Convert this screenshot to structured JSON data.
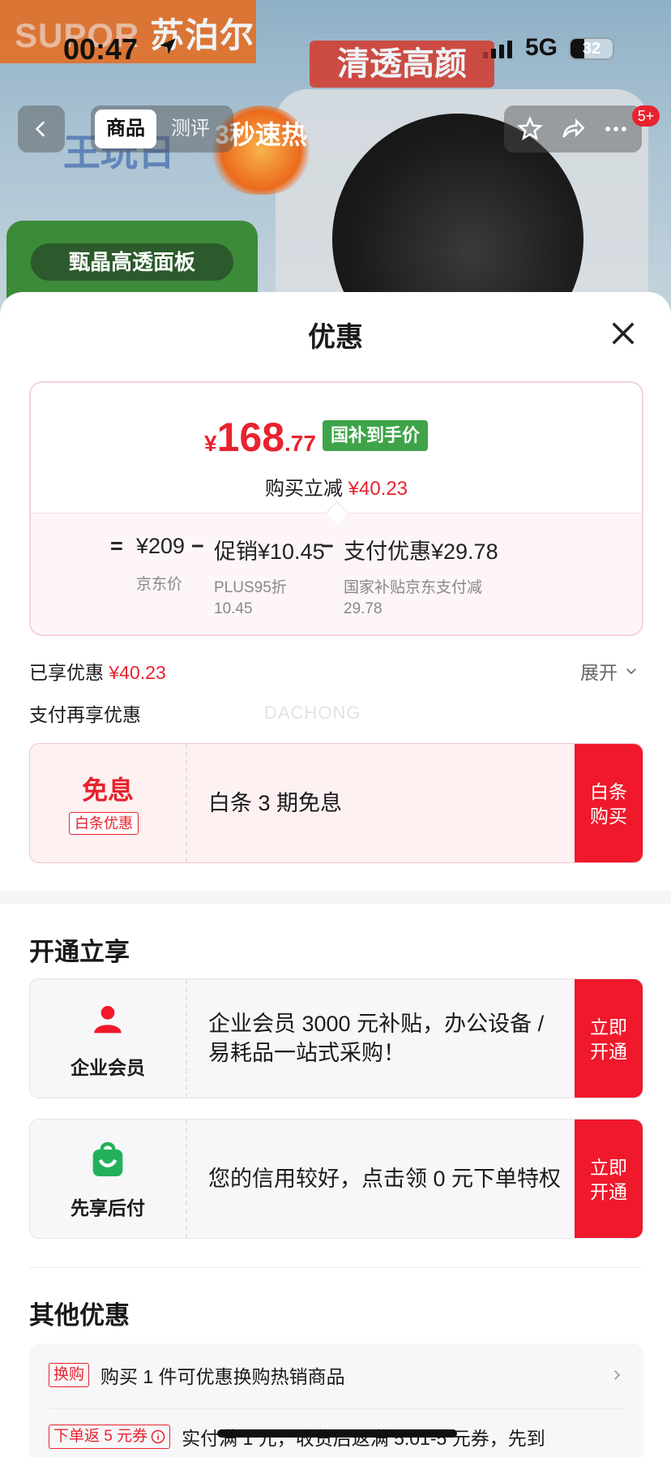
{
  "status_bar": {
    "time": "00:47",
    "network": "5G",
    "battery": "32"
  },
  "background": {
    "brand_en": "SUPOR",
    "brand_cn": "苏泊尔",
    "slogan": "清透高颜",
    "flame_text": "3秒速热",
    "green_tag": "甄晶高透面板"
  },
  "nav": {
    "tabs": [
      "商品",
      "测评"
    ],
    "badge": "5+"
  },
  "sheet": {
    "title": "优惠"
  },
  "price_card": {
    "currency": "¥",
    "price_int": "168",
    "price_dec": ".77",
    "price_tag": "国补到手价",
    "reduce_label": "购买立减",
    "reduce_value": "¥40.23",
    "formula": {
      "equals": "=",
      "minus": "−",
      "items": [
        {
          "value": "¥209",
          "desc": "京东价"
        },
        {
          "value": "促销¥10.45",
          "desc": "PLUS95折",
          "desc2": "10.45"
        },
        {
          "value": "支付优惠¥29.78",
          "desc": "国家补贴京东支付减",
          "desc2": "29.78"
        }
      ]
    }
  },
  "enjoyed": {
    "label": "已享优惠",
    "value": "¥40.23",
    "expand": "展开"
  },
  "pay_more": {
    "title": "支付再享优惠",
    "watermark": "DACHONG"
  },
  "baitiao": {
    "title": "免息",
    "tag": "白条优惠",
    "desc": "白条 3 期免息",
    "button": "白条购买"
  },
  "open_section": {
    "title": "开通立享",
    "items": [
      {
        "label": "企业会员",
        "desc": "企业会员 3000 元补贴，办公设备 / 易耗品一站式采购！",
        "button": "立即开通",
        "icon": "person-icon"
      },
      {
        "label": "先享后付",
        "desc": "您的信用较好，点击领 0 元下单特权",
        "button": "立即开通",
        "icon": "shopping-bag-icon"
      }
    ]
  },
  "other_section": {
    "title": "其他优惠",
    "items": [
      {
        "tag": "换购",
        "text": "购买 1 件可优惠换购热销商品"
      },
      {
        "tag": "下单返 5 元券",
        "text": "实付满 1 元，收货后返满 5.01-5 元券，先到"
      }
    ]
  },
  "colors": {
    "accent_red": "#e8232f",
    "button_red": "#f0182b",
    "tag_green": "#3fa449"
  }
}
